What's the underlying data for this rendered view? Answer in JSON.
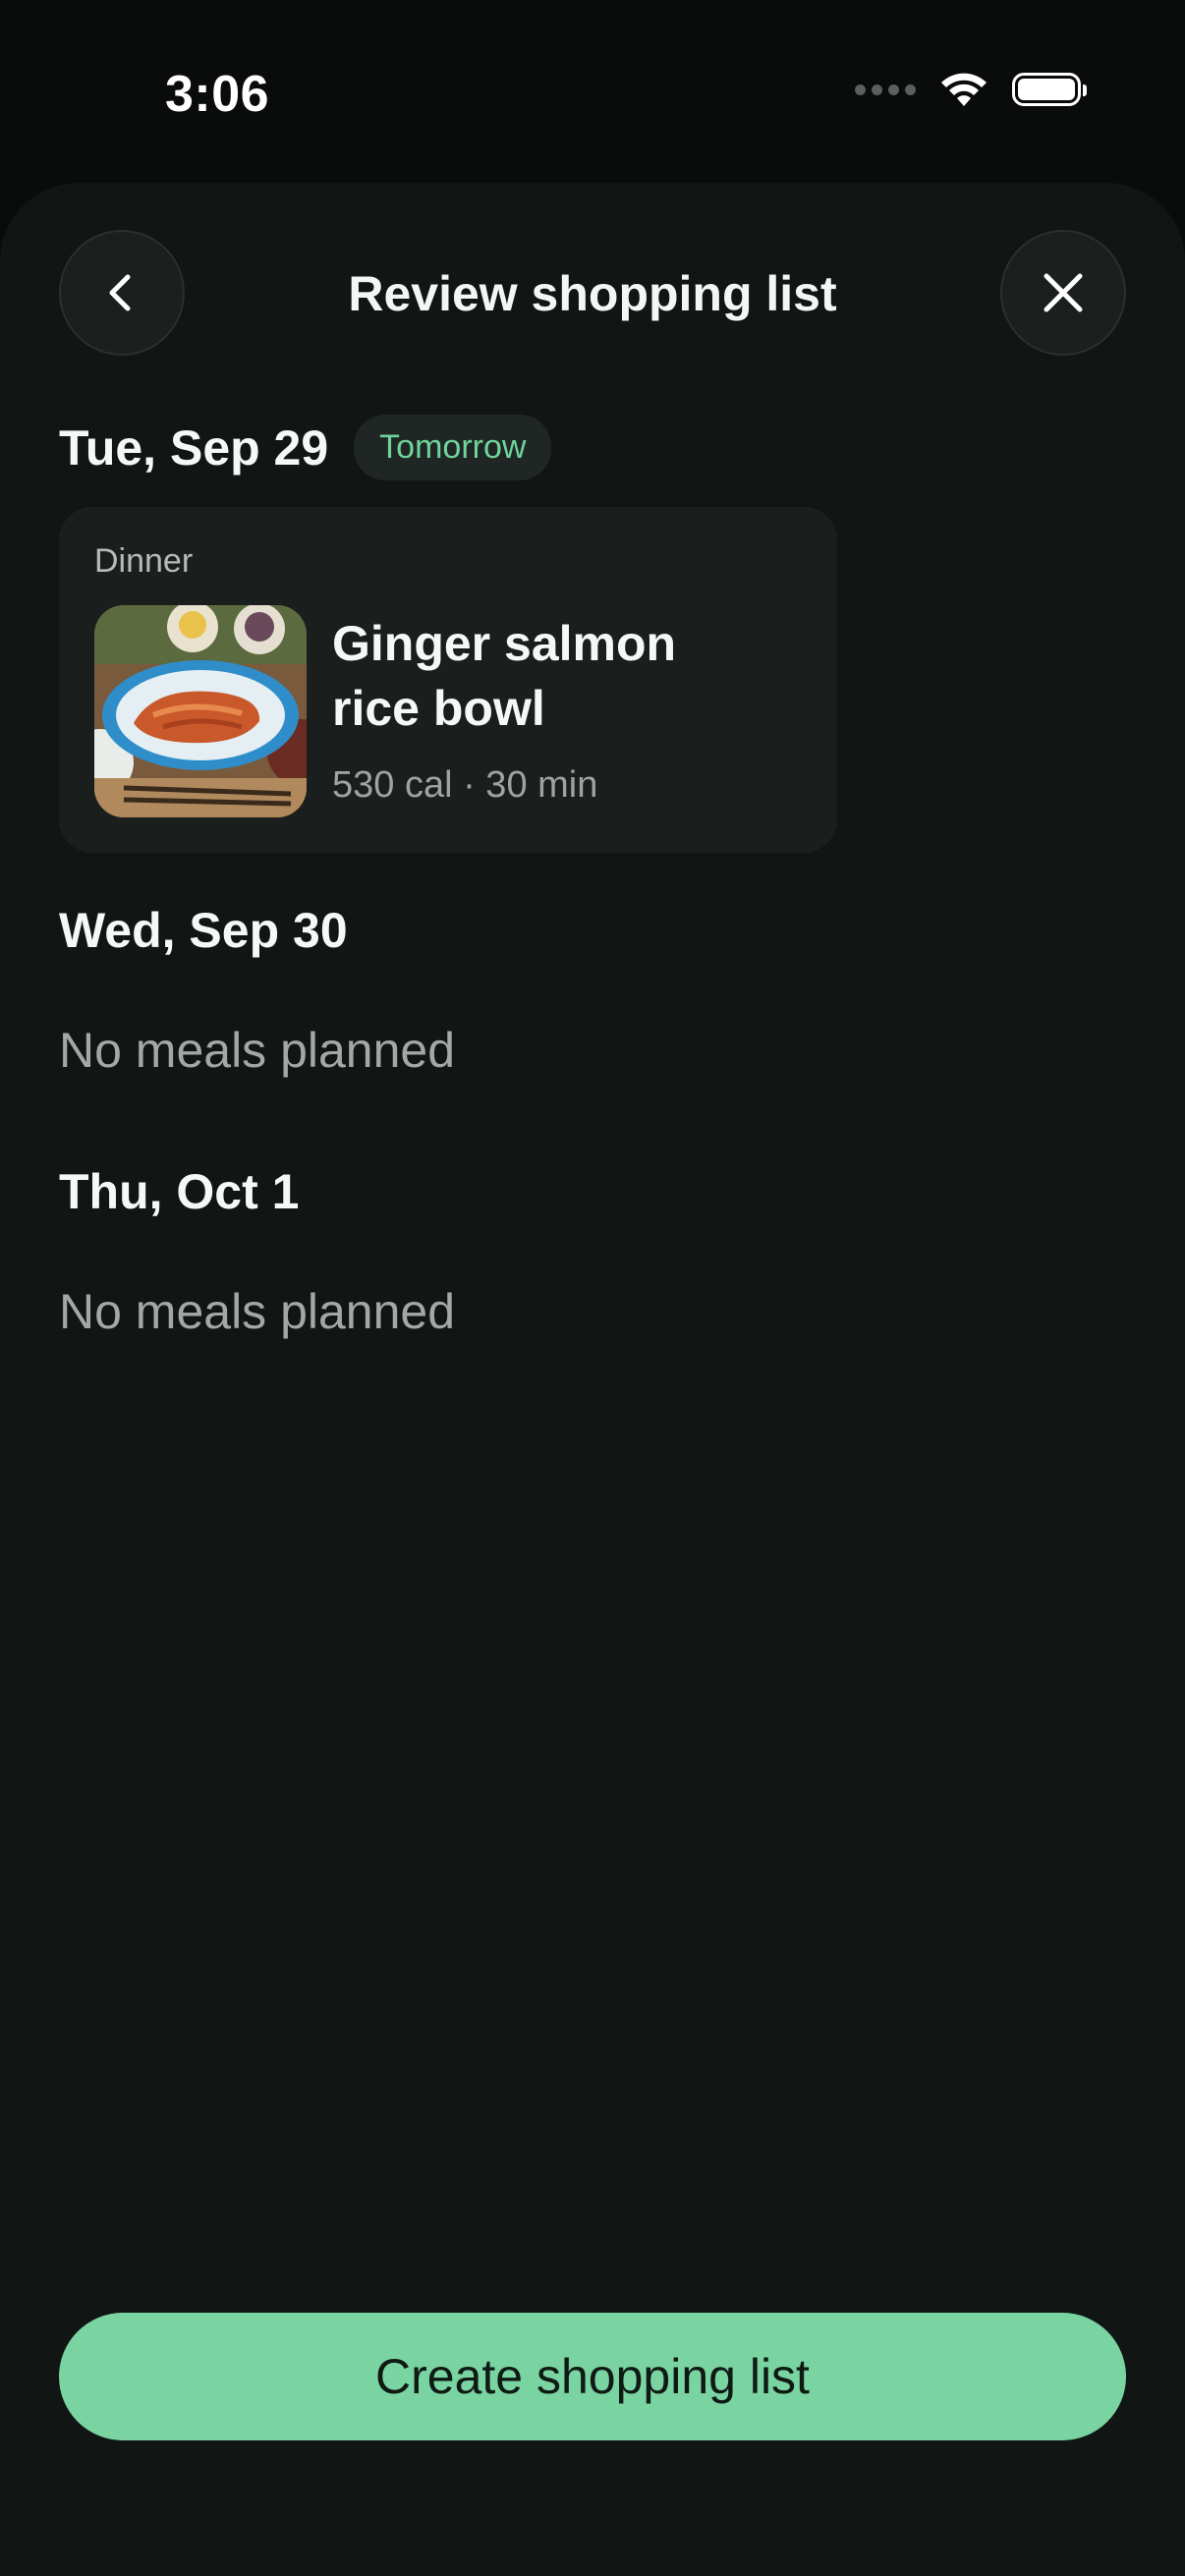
{
  "status_bar": {
    "time": "3:06"
  },
  "header": {
    "title": "Review shopping list",
    "back_icon": "chevron-left-icon",
    "close_icon": "close-icon"
  },
  "days": [
    {
      "title": "Tue, Sep 29",
      "badge": "Tomorrow",
      "meal": {
        "type": "Dinner",
        "name": "Ginger salmon rice bowl",
        "meta": "530 cal · 30 min"
      }
    },
    {
      "title": "Wed, Sep 30",
      "empty_text": "No meals planned"
    },
    {
      "title": "Thu, Oct 1",
      "empty_text": "No meals planned"
    }
  ],
  "cta": {
    "label": "Create shopping list"
  },
  "colors": {
    "accent": "#7ad4a2",
    "badge_text": "#6fd39b",
    "sheet_bg": "#111513",
    "card_bg": "#1a1f1d"
  }
}
